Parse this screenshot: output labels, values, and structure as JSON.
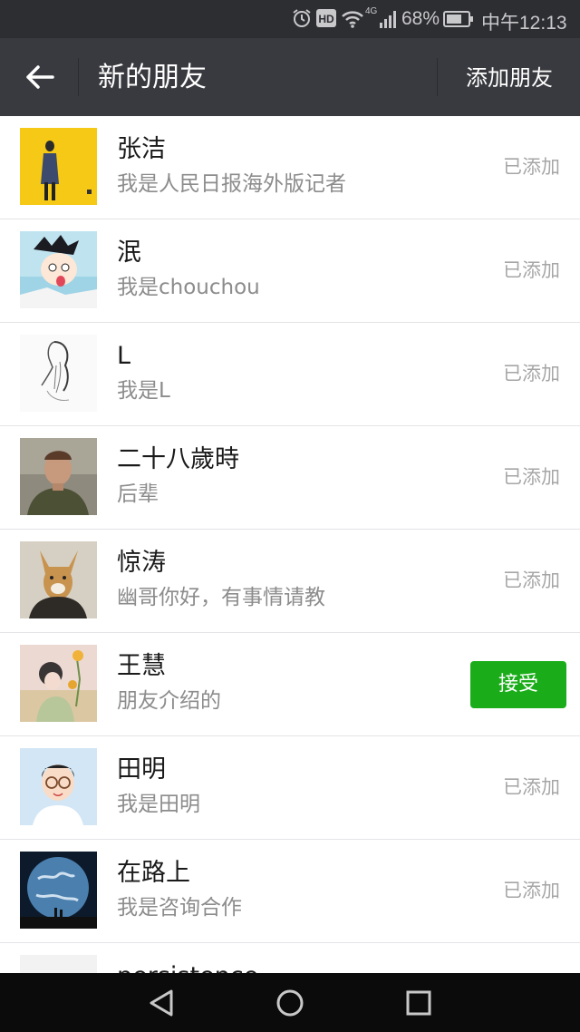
{
  "status_bar": {
    "icons": [
      "alarm-icon",
      "hd-icon",
      "wifi-icon",
      "4g-signal-icon",
      "battery-icon"
    ],
    "network": "4G",
    "battery": "68%",
    "time": "中午12:13"
  },
  "header": {
    "back_icon": "back-arrow-icon",
    "title": "新的朋友",
    "add_friend_label": "添加朋友"
  },
  "friends": [
    {
      "name": "张洁",
      "message": "我是人民日报海外版记者",
      "status": "已添加"
    },
    {
      "name": "泯",
      "message": "我是chouchou",
      "status": "已添加"
    },
    {
      "name": "L",
      "message": "我是L",
      "status": "已添加"
    },
    {
      "name": "二十八歲時",
      "message": "后辈",
      "status": "已添加"
    },
    {
      "name": "惊涛",
      "message": "幽哥你好，有事情请教",
      "status": "已添加"
    },
    {
      "name": "王慧",
      "message": "朋友介绍的",
      "action": "接受"
    },
    {
      "name": "田明",
      "message": "我是田明",
      "status": "已添加"
    },
    {
      "name": "在路上",
      "message": "我是咨询合作",
      "status": "已添加"
    },
    {
      "name": "persistence"
    }
  ],
  "colors": {
    "status_bar_bg": "#2d2e32",
    "title_bar_bg": "#393a3f",
    "accept_button": "#1aad19",
    "nav_bar_bg": "#0b0b0b"
  },
  "nav_bar": {
    "icons": [
      "back-triangle-icon",
      "home-circle-icon",
      "recents-square-icon"
    ]
  }
}
